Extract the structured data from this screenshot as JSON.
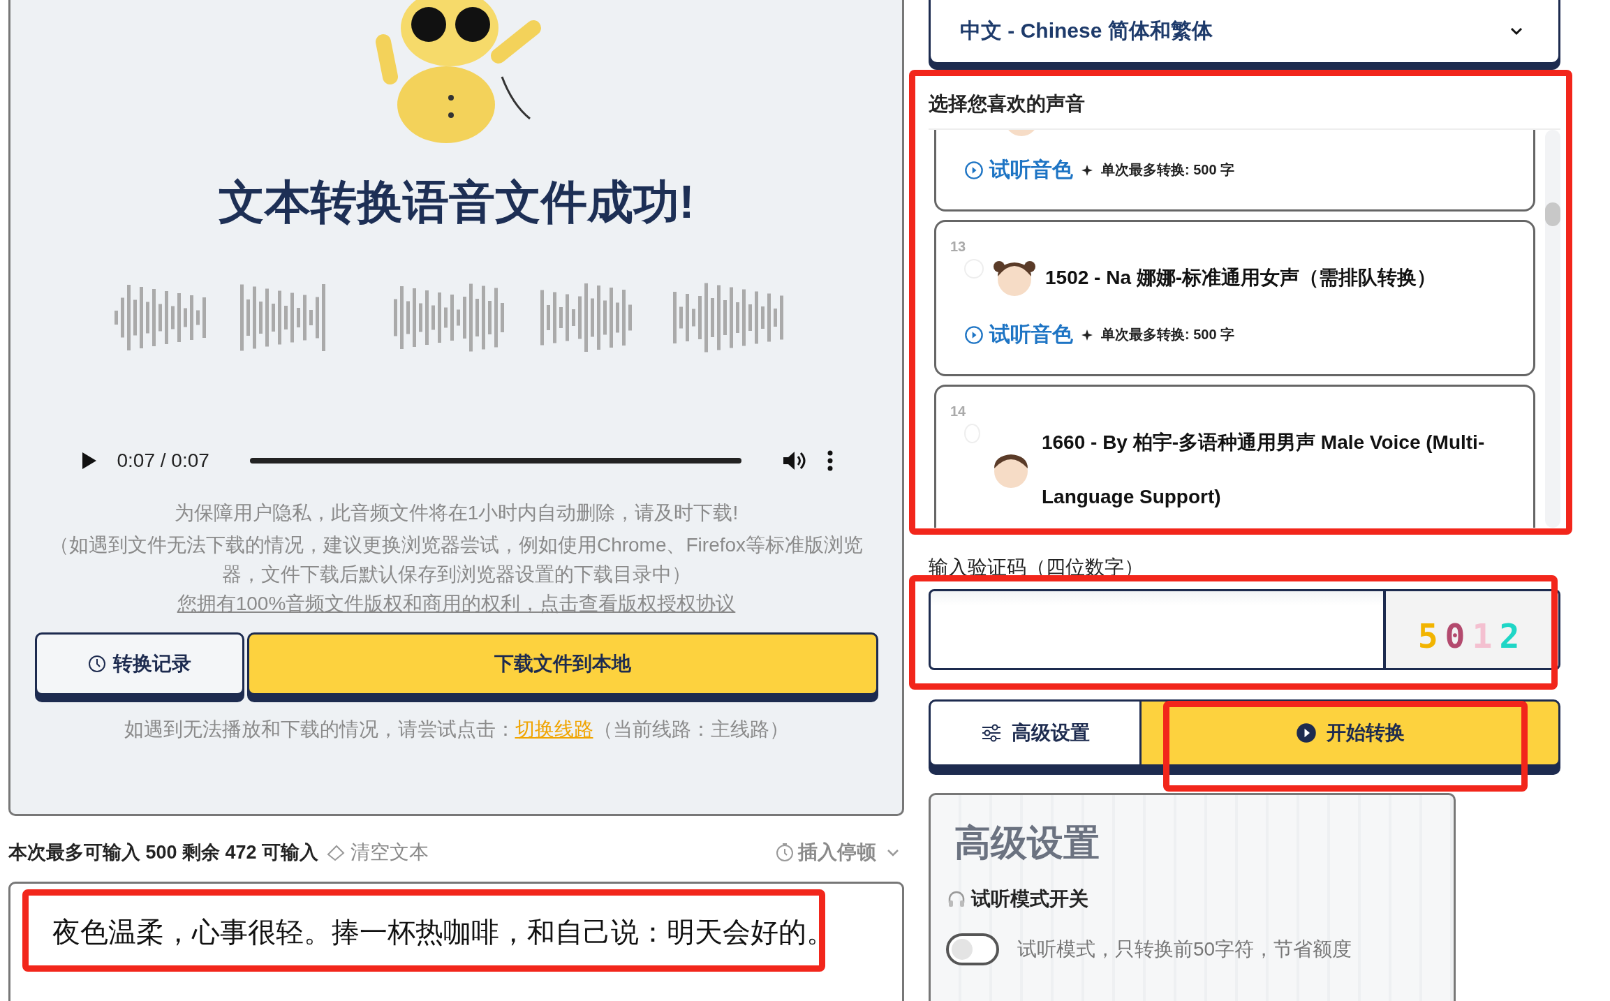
{
  "left_panel": {
    "title": "文本转换语音文件成功!",
    "player": {
      "time": "0:07 / 0:07",
      "level": 1
    },
    "notices": [
      "为保障用户隐私，此音频文件将在1小时内自动删除，请及时下载!",
      "（如遇到文件无法下载的情况，建议更换浏览器尝试，例如使用Chrome、Firefox等标准版浏览器，文件下载后默认保存到浏览器设置的下载目录中）"
    ],
    "rights_link": "您拥有100%音频文件版权和商用的权利，点击查看版权授权协议",
    "buttons": [
      {
        "label": "转换记录",
        "kind": "history"
      },
      {
        "label": "下载文件到本地",
        "kind": "primary"
      }
    ],
    "route_note": {
      "before": "如遇到无法播放和下载的情况，请尝试点击：",
      "link": "切换线路",
      "after": "（当前线路：主线路）"
    }
  },
  "editor": {
    "counter": "本次最多可输入 500 剩余 472 可输入",
    "clear": "清空文本",
    "pause": "插入停顿",
    "text": "夜色温柔，心事很轻。捧一杯热咖啡，和自己说：明天会好的。"
  },
  "language_select": {
    "value": "中文 - Chinese 简体和繁体"
  },
  "voices": {
    "title": "选择您喜欢的声音",
    "items": [
      {
        "preview": "试听音色",
        "limit": "单次最多转换: 500 字"
      },
      {
        "number": "13",
        "name": "1502 - Na 娜娜-标准通用女声（需排队转换）",
        "selected": false,
        "preview": "试听音色",
        "limit": "单次最多转换: 500 字"
      },
      {
        "number": "14",
        "name": "1660 - By 柏宇-多语种通用男声 Male Voice (Multi-Language Support)",
        "selected": false
      }
    ]
  },
  "captcha": {
    "label": "输入验证码（四位数字）",
    "code": "5012"
  },
  "actions": [
    {
      "label": "高级设置",
      "kind": "settings"
    },
    {
      "label": "开始转换",
      "kind": "start"
    }
  ],
  "advanced": {
    "title": "高级设置",
    "preview_label": "试听模式开关",
    "preview_mode": {
      "on": false,
      "description": "试听模式，只转换前50字符，节省额度"
    }
  }
}
